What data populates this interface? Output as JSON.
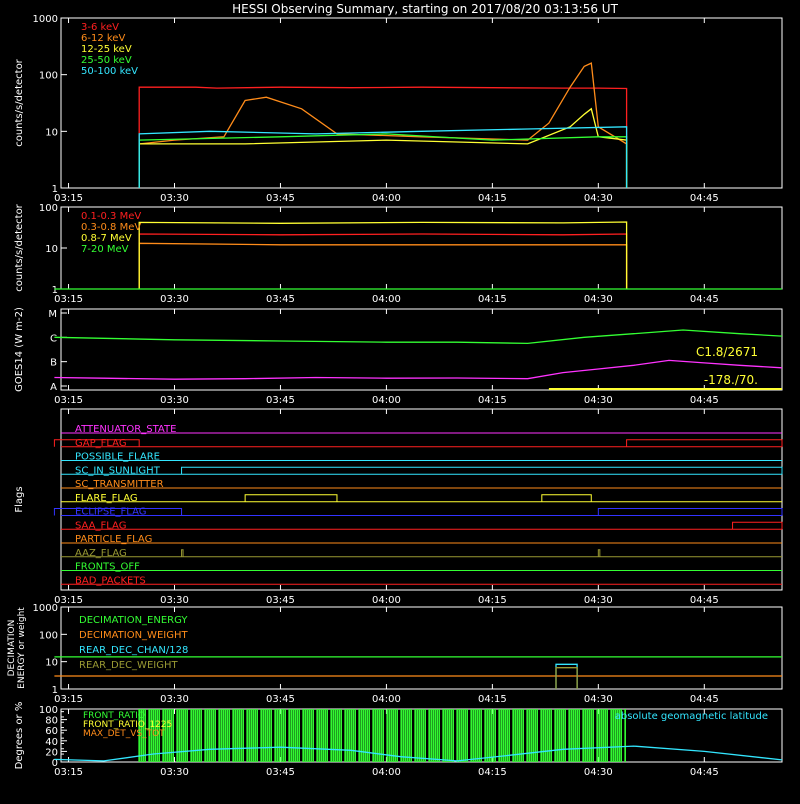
{
  "title": "HESSI Observing Summary, starting on 2017/08/20 03:13:56 UT",
  "time_ticks": [
    "03:15",
    "03:30",
    "03:45",
    "04:00",
    "04:15",
    "04:30",
    "04:45"
  ],
  "chart_data": [
    {
      "id": "lightcurves",
      "type": "line",
      "ylabel": "counts/s/detector",
      "yscale": "log",
      "ylim": [
        1,
        1000
      ],
      "yticks": [
        "1",
        "10",
        "100",
        "1000"
      ],
      "series": [
        {
          "name": "3-6 keV",
          "color": "#ff2020",
          "x": [
            "03:25",
            "03:25",
            "03:33",
            "03:36",
            "03:45",
            "03:55",
            "04:05",
            "04:15",
            "04:25",
            "04:30",
            "04:34",
            "04:34"
          ],
          "y": [
            1,
            60,
            60,
            58,
            60,
            59,
            60,
            59,
            58,
            58,
            57,
            1
          ]
        },
        {
          "name": "6-12 keV",
          "color": "#ff8c1a",
          "x": [
            "03:25",
            "03:25",
            "03:30",
            "03:37",
            "03:40",
            "03:43",
            "03:48",
            "03:53",
            "04:05",
            "04:20",
            "04:23",
            "04:26",
            "04:28",
            "04:29",
            "04:30",
            "04:34",
            "04:34"
          ],
          "y": [
            1,
            6,
            7,
            8,
            35,
            40,
            25,
            9,
            8,
            7,
            14,
            60,
            140,
            160,
            12,
            6,
            1
          ]
        },
        {
          "name": "12-25 keV",
          "color": "#ffff33",
          "x": [
            "03:25",
            "03:25",
            "03:40",
            "04:00",
            "04:20",
            "04:26",
            "04:28",
            "04:29",
            "04:30",
            "04:34",
            "04:34"
          ],
          "y": [
            1,
            6,
            6,
            7,
            6,
            12,
            20,
            25,
            8,
            7,
            1
          ]
        },
        {
          "name": "25-50 keV",
          "color": "#33ff33",
          "x": [
            "03:25",
            "03:25",
            "03:45",
            "04:00",
            "04:15",
            "04:30",
            "04:34",
            "04:34"
          ],
          "y": [
            1,
            7,
            8,
            9,
            7,
            8,
            8,
            1
          ]
        },
        {
          "name": "50-100 keV",
          "color": "#33e6ff",
          "x": [
            "03:25",
            "03:25",
            "03:35",
            "03:50",
            "04:05",
            "04:20",
            "04:34",
            "04:34"
          ],
          "y": [
            1,
            9,
            10,
            9,
            10,
            11,
            12,
            1
          ]
        }
      ]
    },
    {
      "id": "high_energy",
      "type": "line",
      "ylabel": "counts/s/detector",
      "yscale": "log",
      "ylim": [
        1,
        100
      ],
      "yticks": [
        "1",
        "10",
        "100"
      ],
      "series": [
        {
          "name": "0.1-0.3 MeV",
          "color": "#ff2020",
          "x": [
            "03:25",
            "03:25",
            "03:45",
            "04:05",
            "04:25",
            "04:34",
            "04:34"
          ],
          "y": [
            1,
            22,
            21,
            22,
            21,
            22,
            1
          ]
        },
        {
          "name": "0.3-0.8 MeV",
          "color": "#ff8c1a",
          "x": [
            "03:25",
            "03:25",
            "03:45",
            "04:05",
            "04:25",
            "04:34",
            "04:34"
          ],
          "y": [
            1,
            13,
            12,
            12,
            12,
            12,
            1
          ]
        },
        {
          "name": "0.8-7 MeV",
          "color": "#ffff33",
          "x": [
            "03:25",
            "03:25",
            "03:45",
            "04:05",
            "04:25",
            "04:34",
            "04:34"
          ],
          "y": [
            1,
            42,
            40,
            42,
            41,
            43,
            1
          ]
        },
        {
          "name": "7-20 MeV",
          "color": "#33ff33",
          "x": [
            "03:13",
            "04:56"
          ],
          "y": [
            1,
            1
          ]
        }
      ]
    },
    {
      "id": "goes",
      "type": "line",
      "ylabel": "GOES14 (W m-2)",
      "ylevels": [
        "A",
        "B",
        "C",
        "M"
      ],
      "annotations": [
        "C1.8/2671",
        "-178./70."
      ],
      "series": [
        {
          "color": "#33ff33",
          "x": [
            "03:13",
            "03:30",
            "03:45",
            "04:00",
            "04:10",
            "04:20",
            "04:28",
            "04:35",
            "04:42",
            "04:50",
            "04:56"
          ],
          "y": [
            2.0,
            1.9,
            1.85,
            1.8,
            1.8,
            1.75,
            2.0,
            2.15,
            2.3,
            2.15,
            2.05
          ]
        },
        {
          "color": "#ff33ff",
          "x": [
            "03:13",
            "03:20",
            "03:30",
            "03:40",
            "03:50",
            "04:00",
            "04:10",
            "04:20",
            "04:25",
            "04:30",
            "04:35",
            "04:40",
            "04:45",
            "04:50",
            "04:56"
          ],
          "y": [
            0.35,
            0.32,
            0.28,
            0.3,
            0.35,
            0.32,
            0.33,
            0.3,
            0.55,
            0.7,
            0.85,
            1.05,
            0.95,
            0.85,
            0.75
          ]
        }
      ]
    },
    {
      "id": "flags",
      "type": "timeline",
      "ylabel": "Flags",
      "flags": [
        {
          "name": "ATTENUATOR_STATE",
          "color": "#ff33ff",
          "segments": []
        },
        {
          "name": "GAP_FLAG",
          "color": "#ff2020",
          "segments": [
            [
              "03:13",
              "03:25"
            ],
            [
              "04:34",
              "04:56"
            ]
          ]
        },
        {
          "name": "POSSIBLE_FLARE",
          "color": "#33e6ff",
          "segments": []
        },
        {
          "name": "SC_IN_SUNLIGHT",
          "color": "#33e6ff",
          "segments": [
            [
              "03:31",
              "04:56"
            ]
          ]
        },
        {
          "name": "SC_TRANSMITTER",
          "color": "#ff8c1a",
          "segments": []
        },
        {
          "name": "FLARE_FLAG",
          "color": "#ffff33",
          "segments": [
            [
              "03:40",
              "03:53"
            ],
            [
              "04:22",
              "04:29"
            ]
          ]
        },
        {
          "name": "ECLIPSE_FLAG",
          "color": "#3333ff",
          "segments": [
            [
              "03:13",
              "03:31"
            ],
            [
              "04:30",
              "04:56"
            ]
          ]
        },
        {
          "name": "SAA_FLAG",
          "color": "#ff2020",
          "segments": [
            [
              "04:49",
              "04:56"
            ]
          ]
        },
        {
          "name": "PARTICLE_FLAG",
          "color": "#ff8c1a",
          "segments": []
        },
        {
          "name": "AAZ_FLAG",
          "color": "#999933",
          "segments": [
            [
              "03:31",
              "03:31"
            ],
            [
              "04:30",
              "04:30"
            ]
          ]
        },
        {
          "name": "FRONTS_OFF",
          "color": "#33ff33",
          "segments": []
        },
        {
          "name": "BAD_PACKETS",
          "color": "#ff2020",
          "segments": []
        }
      ]
    },
    {
      "id": "decimation",
      "type": "line",
      "ylabel": "DECIMATION ENERGY or weight",
      "yscale": "log",
      "ylim": [
        1,
        1000
      ],
      "yticks": [
        "1",
        "10",
        "100",
        "1000"
      ],
      "series": [
        {
          "name": "DECIMATION_ENERGY",
          "color": "#33ff33",
          "x": [
            "03:13",
            "04:56"
          ],
          "y": [
            15,
            15
          ]
        },
        {
          "name": "DECIMATION_WEIGHT",
          "color": "#ff8c1a",
          "x": [
            "03:13",
            "04:56"
          ],
          "y": [
            3,
            3
          ]
        },
        {
          "name": "REAR_DEC_CHAN/128",
          "color": "#33e6ff",
          "x": [
            "04:24",
            "04:24",
            "04:27",
            "04:27"
          ],
          "y": [
            1,
            8,
            8,
            1
          ]
        },
        {
          "name": "REAR_DEC_WEIGHT",
          "color": "#999933",
          "x": [
            "04:24",
            "04:24",
            "04:27",
            "04:27"
          ],
          "y": [
            1,
            6,
            6,
            1
          ]
        }
      ]
    },
    {
      "id": "ratios",
      "type": "line",
      "ylabel": "Degrees or %",
      "ylim": [
        0,
        100
      ],
      "yticks": [
        "0",
        "20",
        "40",
        "60",
        "80",
        "100"
      ],
      "yminor": [
        "15",
        "25",
        "35",
        "45",
        "55",
        "65",
        "75",
        "85",
        "95"
      ],
      "legend_right": "absolute geomagnetic latitude",
      "series": [
        {
          "name": "FRONT_RATIO",
          "color": "#33ff33",
          "x": [
            "03:25",
            "04:34"
          ],
          "y": [
            100,
            100
          ]
        },
        {
          "name": "FRONT_RATIO_1225",
          "color": "#ffff33",
          "x": [],
          "y": []
        },
        {
          "name": "MAX_DET_VS_TOT",
          "color": "#ff8c1a",
          "x": [],
          "y": []
        },
        {
          "name": "absolute geomagnetic latitude",
          "color": "#33e6ff",
          "x": [
            "03:13",
            "03:20",
            "03:27",
            "03:35",
            "03:45",
            "03:55",
            "04:02",
            "04:10",
            "04:17",
            "04:25",
            "04:35",
            "04:45",
            "04:56"
          ],
          "y": [
            5,
            2,
            15,
            24,
            28,
            22,
            10,
            2,
            12,
            24,
            30,
            20,
            4
          ]
        }
      ]
    }
  ]
}
